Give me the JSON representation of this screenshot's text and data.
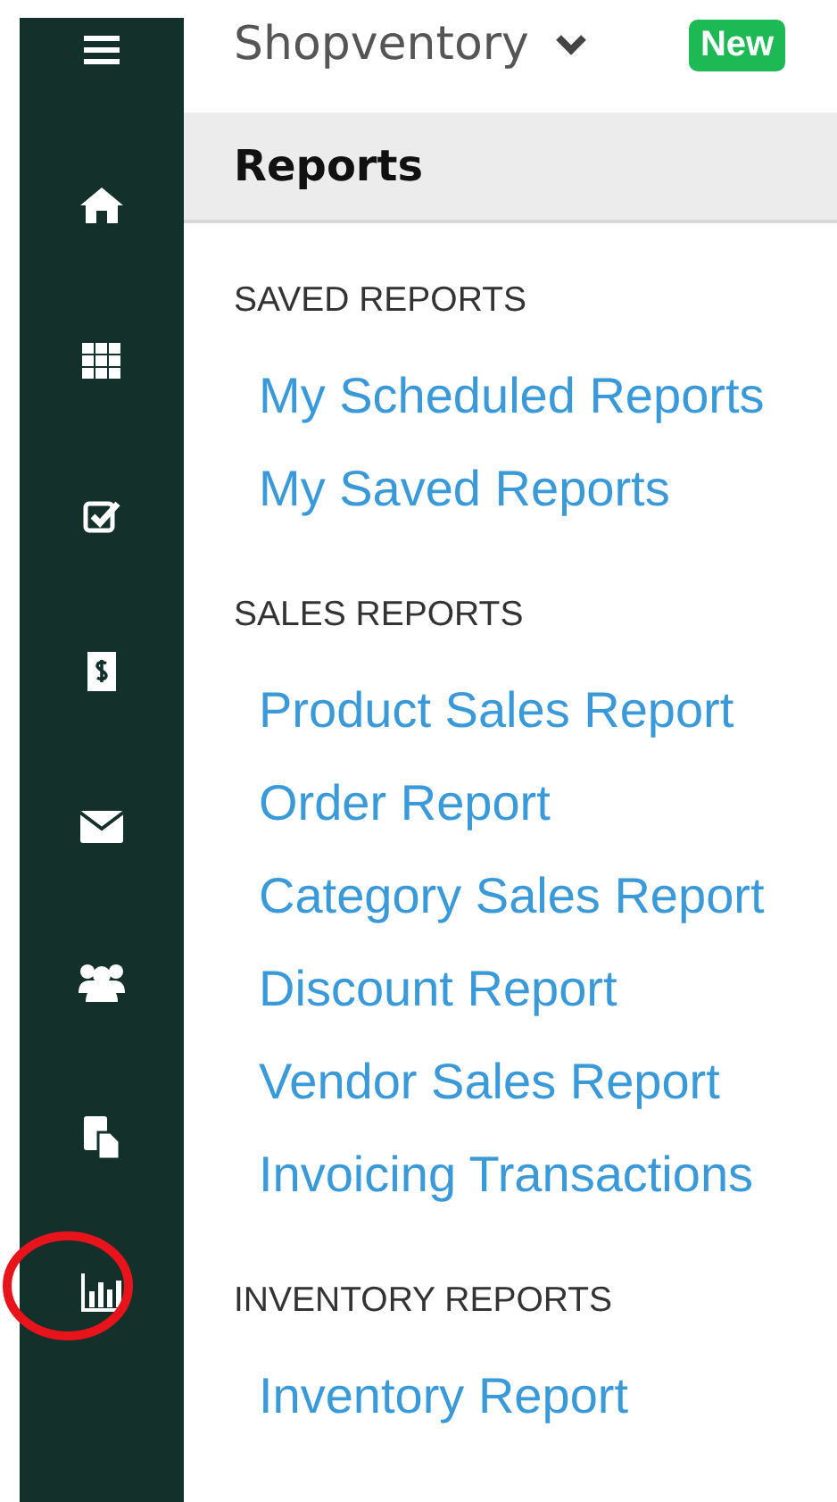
{
  "nav": [
    {
      "kind": "menu",
      "circled": false
    },
    {
      "kind": "home",
      "circled": false
    },
    {
      "kind": "grid",
      "circled": false
    },
    {
      "kind": "check",
      "circled": false
    },
    {
      "kind": "receipt",
      "circled": false
    },
    {
      "kind": "mail",
      "circled": false
    },
    {
      "kind": "users",
      "circled": false
    },
    {
      "kind": "docs",
      "circled": false
    },
    {
      "kind": "chart",
      "circled": true
    }
  ],
  "header": {
    "store": "Shopventory",
    "badge": "New"
  },
  "page_title": "Reports",
  "sections": [
    {
      "heading": "SAVED REPORTS",
      "links": [
        "My Scheduled Reports",
        "My Saved Reports"
      ]
    },
    {
      "heading": "SALES REPORTS",
      "links": [
        "Product Sales Report",
        "Order Report",
        "Category Sales Report",
        "Discount Report",
        "Vendor Sales Report",
        "Invoicing Transactions"
      ]
    },
    {
      "heading": "INVENTORY REPORTS",
      "links": [
        "Inventory Report"
      ]
    }
  ]
}
